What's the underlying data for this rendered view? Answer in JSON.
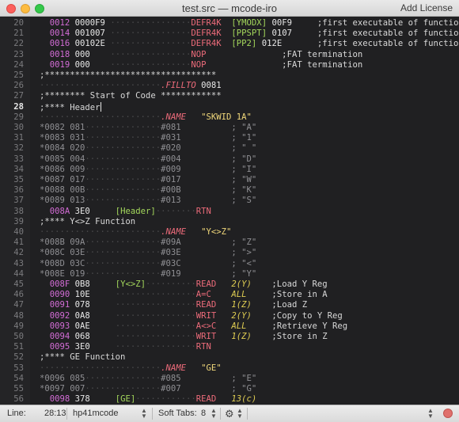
{
  "window": {
    "title": "test.src — mcode-iro",
    "add_license": "Add License"
  },
  "editor": {
    "current_line": 28,
    "lines": [
      {
        "n": "20",
        "tokens": [
          [
            "  ",
            "c"
          ],
          [
            "0012",
            "addr"
          ],
          [
            " 0000F9 ",
            "hex"
          ],
          [
            "                ",
            "dot"
          ],
          [
            "DEFR4K",
            "mnem"
          ],
          [
            "  ",
            "c"
          ],
          [
            "[YMODX]",
            "label"
          ],
          [
            " 00F9",
            "num"
          ],
          [
            "     ;first executable of function",
            "cmt"
          ]
        ]
      },
      {
        "n": "21",
        "tokens": [
          [
            "  ",
            "c"
          ],
          [
            "0014",
            "addr"
          ],
          [
            " 001007 ",
            "hex"
          ],
          [
            "                ",
            "dot"
          ],
          [
            "DEFR4K",
            "mnem"
          ],
          [
            "  ",
            "c"
          ],
          [
            "[PPSPT]",
            "label"
          ],
          [
            " 0107",
            "num"
          ],
          [
            "     ;first executable of function",
            "cmt"
          ]
        ]
      },
      {
        "n": "22",
        "tokens": [
          [
            "  ",
            "c"
          ],
          [
            "0016",
            "addr"
          ],
          [
            " 00102E ",
            "hex"
          ],
          [
            "                ",
            "dot"
          ],
          [
            "DEFR4K",
            "mnem"
          ],
          [
            "  ",
            "c"
          ],
          [
            "[PP2]",
            "label"
          ],
          [
            " 012E",
            "num"
          ],
          [
            "       ;first executable of function",
            "cmt"
          ]
        ]
      },
      {
        "n": "23",
        "tokens": [
          [
            "  ",
            "c"
          ],
          [
            "0018",
            "addr"
          ],
          [
            " 000    ",
            "hex"
          ],
          [
            "                ",
            "dot"
          ],
          [
            "NOP",
            "mnem"
          ],
          [
            "               ;FAT termination",
            "cmt"
          ]
        ]
      },
      {
        "n": "24",
        "tokens": [
          [
            "  ",
            "c"
          ],
          [
            "0019",
            "addr"
          ],
          [
            " 000    ",
            "hex"
          ],
          [
            "                ",
            "dot"
          ],
          [
            "NOP",
            "mnem"
          ],
          [
            "               ;FAT termination",
            "cmt"
          ]
        ]
      },
      {
        "n": "25",
        "tokens": [
          [
            ";**********************************",
            "cmt"
          ]
        ]
      },
      {
        "n": "26",
        "tokens": [
          [
            "                        ",
            "dot"
          ],
          [
            ".FILLTO",
            "dir"
          ],
          [
            " 0081",
            "num"
          ]
        ]
      },
      {
        "n": "27",
        "tokens": [
          [
            ";******** Start of Code ************",
            "cmt"
          ]
        ]
      },
      {
        "n": "28",
        "tokens": [
          [
            ";**** Header",
            "cmt"
          ],
          [
            "|cursor",
            "cursor"
          ]
        ]
      },
      {
        "n": "29",
        "tokens": [
          [
            "                        ",
            "dot"
          ],
          [
            ".NAME",
            "dir"
          ],
          [
            "   ",
            "c"
          ],
          [
            "\"SKWID 1A\"",
            "str"
          ]
        ]
      },
      {
        "n": "30",
        "tokens": [
          [
            "*0082 081",
            "grey"
          ],
          [
            "               ",
            "dot"
          ],
          [
            "#081",
            "grey"
          ],
          [
            "          ; \"A\"",
            "grey"
          ]
        ]
      },
      {
        "n": "31",
        "tokens": [
          [
            "*0083 031",
            "grey"
          ],
          [
            "               ",
            "dot"
          ],
          [
            "#031",
            "grey"
          ],
          [
            "          ; \"1\"",
            "grey"
          ]
        ]
      },
      {
        "n": "32",
        "tokens": [
          [
            "*0084 020",
            "grey"
          ],
          [
            "               ",
            "dot"
          ],
          [
            "#020",
            "grey"
          ],
          [
            "          ; \" \"",
            "grey"
          ]
        ]
      },
      {
        "n": "33",
        "tokens": [
          [
            "*0085 004",
            "grey"
          ],
          [
            "               ",
            "dot"
          ],
          [
            "#004",
            "grey"
          ],
          [
            "          ; \"D\"",
            "grey"
          ]
        ]
      },
      {
        "n": "34",
        "tokens": [
          [
            "*0086 009",
            "grey"
          ],
          [
            "               ",
            "dot"
          ],
          [
            "#009",
            "grey"
          ],
          [
            "          ; \"I\"",
            "grey"
          ]
        ]
      },
      {
        "n": "35",
        "tokens": [
          [
            "*0087 017",
            "grey"
          ],
          [
            "               ",
            "dot"
          ],
          [
            "#017",
            "grey"
          ],
          [
            "          ; \"W\"",
            "grey"
          ]
        ]
      },
      {
        "n": "36",
        "tokens": [
          [
            "*0088 00B",
            "grey"
          ],
          [
            "               ",
            "dot"
          ],
          [
            "#00B",
            "grey"
          ],
          [
            "          ; \"K\"",
            "grey"
          ]
        ]
      },
      {
        "n": "37",
        "tokens": [
          [
            "*0089 013",
            "grey"
          ],
          [
            "               ",
            "dot"
          ],
          [
            "#013",
            "grey"
          ],
          [
            "          ; \"S\"",
            "grey"
          ]
        ]
      },
      {
        "n": "38",
        "tokens": [
          [
            "  ",
            "c"
          ],
          [
            "008A",
            "addr"
          ],
          [
            " 3E0     ",
            "hex"
          ],
          [
            "[Header]",
            "label"
          ],
          [
            "        ",
            "dot"
          ],
          [
            "RTN",
            "mnem"
          ]
        ]
      },
      {
        "n": "39",
        "tokens": [
          [
            ";**** Y<>Z Function",
            "cmt"
          ]
        ]
      },
      {
        "n": "40",
        "tokens": [
          [
            "                        ",
            "dot"
          ],
          [
            ".NAME",
            "dir"
          ],
          [
            "   ",
            "c"
          ],
          [
            "\"Y<>Z\"",
            "str"
          ]
        ]
      },
      {
        "n": "41",
        "tokens": [
          [
            "*008B 09A",
            "grey"
          ],
          [
            "               ",
            "dot"
          ],
          [
            "#09A",
            "grey"
          ],
          [
            "          ; \"Z\"",
            "grey"
          ]
        ]
      },
      {
        "n": "42",
        "tokens": [
          [
            "*008C 03E",
            "grey"
          ],
          [
            "               ",
            "dot"
          ],
          [
            "#03E",
            "grey"
          ],
          [
            "          ; \">\"",
            "grey"
          ]
        ]
      },
      {
        "n": "43",
        "tokens": [
          [
            "*008D 03C",
            "grey"
          ],
          [
            "               ",
            "dot"
          ],
          [
            "#03C",
            "grey"
          ],
          [
            "          ; \"<\"",
            "grey"
          ]
        ]
      },
      {
        "n": "44",
        "tokens": [
          [
            "*008E 019",
            "grey"
          ],
          [
            "               ",
            "dot"
          ],
          [
            "#019",
            "grey"
          ],
          [
            "          ; \"Y\"",
            "grey"
          ]
        ]
      },
      {
        "n": "45",
        "tokens": [
          [
            "  ",
            "c"
          ],
          [
            "008F",
            "addr"
          ],
          [
            " 0B8     ",
            "hex"
          ],
          [
            "[Y<>Z]",
            "label"
          ],
          [
            "          ",
            "dot"
          ],
          [
            "READ",
            "mnem"
          ],
          [
            "   ",
            "c"
          ],
          [
            "2(Y)",
            "operand"
          ],
          [
            "    ;Load Y Reg",
            "cmt"
          ]
        ]
      },
      {
        "n": "46",
        "tokens": [
          [
            "  ",
            "c"
          ],
          [
            "0090",
            "addr"
          ],
          [
            " 10E     ",
            "hex"
          ],
          [
            "                ",
            "dot"
          ],
          [
            "A=C",
            "mnem"
          ],
          [
            "    ",
            "c"
          ],
          [
            "ALL",
            "operand"
          ],
          [
            "     ;Store in A",
            "cmt"
          ]
        ]
      },
      {
        "n": "47",
        "tokens": [
          [
            "  ",
            "c"
          ],
          [
            "0091",
            "addr"
          ],
          [
            " 078     ",
            "hex"
          ],
          [
            "                ",
            "dot"
          ],
          [
            "READ",
            "mnem"
          ],
          [
            "   ",
            "c"
          ],
          [
            "1(Z)",
            "operand"
          ],
          [
            "    ;Load Z",
            "cmt"
          ]
        ]
      },
      {
        "n": "48",
        "tokens": [
          [
            "  ",
            "c"
          ],
          [
            "0092",
            "addr"
          ],
          [
            " 0A8     ",
            "hex"
          ],
          [
            "                ",
            "dot"
          ],
          [
            "WRIT",
            "mnem"
          ],
          [
            "   ",
            "c"
          ],
          [
            "2(Y)",
            "operand"
          ],
          [
            "    ;Copy to Y Reg",
            "cmt"
          ]
        ]
      },
      {
        "n": "49",
        "tokens": [
          [
            "  ",
            "c"
          ],
          [
            "0093",
            "addr"
          ],
          [
            " 0AE     ",
            "hex"
          ],
          [
            "                ",
            "dot"
          ],
          [
            "A<>C",
            "mnem"
          ],
          [
            "   ",
            "c"
          ],
          [
            "ALL",
            "operand"
          ],
          [
            "     ;Retrieve Y Reg",
            "cmt"
          ]
        ]
      },
      {
        "n": "50",
        "tokens": [
          [
            "  ",
            "c"
          ],
          [
            "0094",
            "addr"
          ],
          [
            " 068     ",
            "hex"
          ],
          [
            "                ",
            "dot"
          ],
          [
            "WRIT",
            "mnem"
          ],
          [
            "   ",
            "c"
          ],
          [
            "1(Z)",
            "operand"
          ],
          [
            "    ;Store in Z",
            "cmt"
          ]
        ]
      },
      {
        "n": "51",
        "tokens": [
          [
            "  ",
            "c"
          ],
          [
            "0095",
            "addr"
          ],
          [
            " 3E0     ",
            "hex"
          ],
          [
            "                ",
            "dot"
          ],
          [
            "RTN",
            "mnem"
          ]
        ]
      },
      {
        "n": "52",
        "tokens": [
          [
            ";**** GE Function",
            "cmt"
          ]
        ]
      },
      {
        "n": "53",
        "tokens": [
          [
            "                        ",
            "dot"
          ],
          [
            ".NAME",
            "dir"
          ],
          [
            "   ",
            "c"
          ],
          [
            "\"GE\"",
            "str"
          ]
        ]
      },
      {
        "n": "54",
        "tokens": [
          [
            "*0096 085",
            "grey"
          ],
          [
            "               ",
            "dot"
          ],
          [
            "#085",
            "grey"
          ],
          [
            "          ; \"E\"",
            "grey"
          ]
        ]
      },
      {
        "n": "55",
        "tokens": [
          [
            "*0097 007",
            "grey"
          ],
          [
            "               ",
            "dot"
          ],
          [
            "#007",
            "grey"
          ],
          [
            "          ; \"G\"",
            "grey"
          ]
        ]
      },
      {
        "n": "56",
        "tokens": [
          [
            "  ",
            "c"
          ],
          [
            "0098",
            "addr"
          ],
          [
            " 378     ",
            "hex"
          ],
          [
            "[GE]",
            "label"
          ],
          [
            "            ",
            "dot"
          ],
          [
            "READ",
            "mnem"
          ],
          [
            "   ",
            "c"
          ],
          [
            "13(c)",
            "operand"
          ]
        ]
      }
    ]
  },
  "statusbar": {
    "line_label": "Line:",
    "position": "28:13",
    "syntax": "hp41mcode",
    "tabs_label": "Soft Tabs:",
    "tabs_value": "8"
  },
  "colors": {
    "address": "#d36cd6",
    "mnemonic": "#ec6b7a",
    "label": "#a4d85c",
    "string": "#f0d77a",
    "background": "#202022"
  }
}
